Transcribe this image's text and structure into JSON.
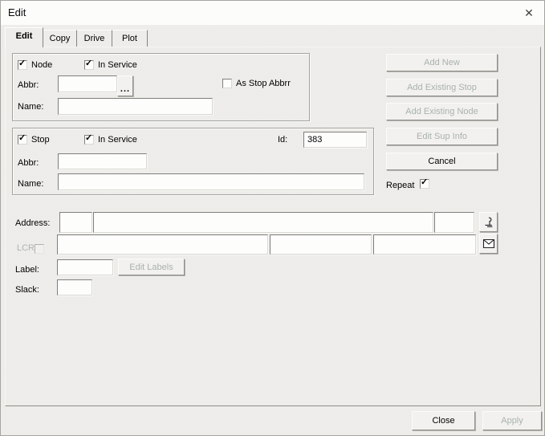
{
  "window": {
    "title": "Edit"
  },
  "icons": {
    "close": "✕",
    "check": "✓",
    "browse": "...",
    "phone": "phone-handset",
    "mail": "envelope"
  },
  "tabs": [
    {
      "label": "Edit",
      "active": true
    },
    {
      "label": "Copy",
      "active": false
    },
    {
      "label": "Drive",
      "active": false
    },
    {
      "label": "Plot",
      "active": false
    }
  ],
  "node_group": {
    "node_label": "Node",
    "node_checked": true,
    "in_service_label": "In Service",
    "in_service_checked": true,
    "abbr_label": "Abbr:",
    "abbr_value": "",
    "as_stop_abbr_label": "As Stop Abbrr",
    "as_stop_abbr_checked": false,
    "name_label": "Name:",
    "name_value": ""
  },
  "stop_group": {
    "stop_label": "Stop",
    "stop_checked": true,
    "in_service_label": "In Service",
    "in_service_checked": true,
    "id_label": "Id:",
    "id_value": "383",
    "abbr_label": "Abbr:",
    "abbr_value": "",
    "name_label": "Name:",
    "name_value": ""
  },
  "actions": {
    "add_new_label": "Add New",
    "add_new_disabled": true,
    "add_existing_stop_label": "Add Existing Stop",
    "add_existing_stop_disabled": true,
    "add_existing_node_label": "Add Existing Node",
    "add_existing_node_disabled": true,
    "edit_sup_info_label": "Edit Sup Info",
    "edit_sup_info_disabled": true,
    "cancel_label": "Cancel",
    "cancel_disabled": false,
    "repeat_label": "Repeat",
    "repeat_checked": true
  },
  "address": {
    "label": "Address:",
    "field1_value": "",
    "field2_value": "",
    "field3_value": "",
    "lcr_label": "LCR",
    "lcr_checked": false,
    "lcr_disabled": true,
    "row2_field1_value": "",
    "row2_field2_value": "",
    "row2_field3_value": ""
  },
  "label_row": {
    "label": "Label:",
    "value": "",
    "edit_labels_label": "Edit Labels",
    "edit_labels_disabled": true
  },
  "slack_row": {
    "label": "Slack:",
    "value": ""
  },
  "footer": {
    "close_label": "Close",
    "close_disabled": false,
    "apply_label": "Apply",
    "apply_disabled": true
  },
  "colors": {
    "dialog_bg": "#f2f1ef",
    "titlebar_bg": "#fcfcfb",
    "field_bg": "#fdfdfc",
    "disabled_text": "#a9b2ab",
    "text": "#000000"
  }
}
